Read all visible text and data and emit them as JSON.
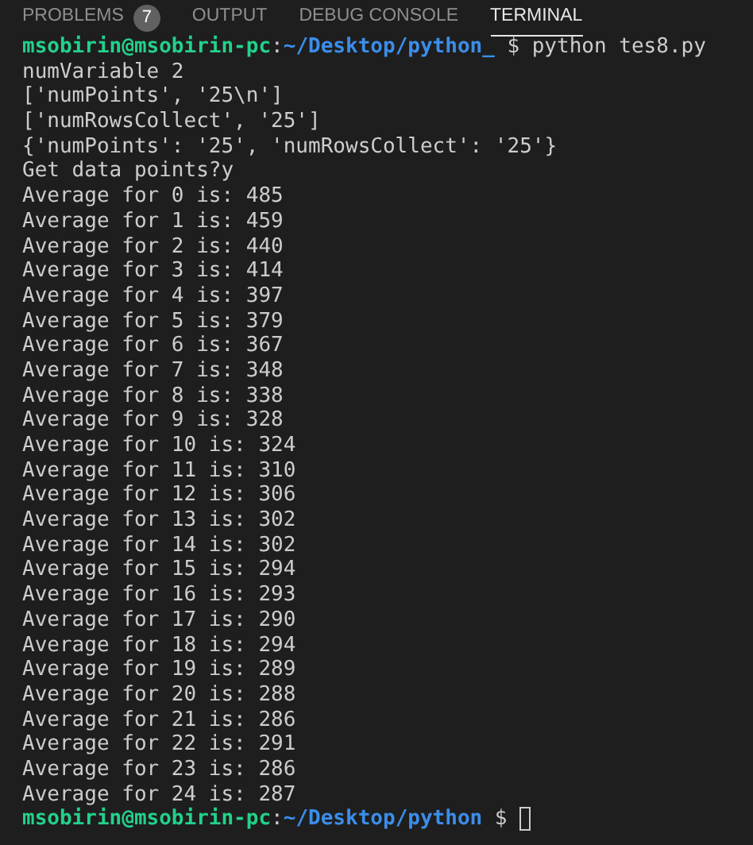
{
  "tabs": [
    {
      "label": "PROBLEMS",
      "badge": "7",
      "selected": false
    },
    {
      "label": "OUTPUT",
      "selected": false
    },
    {
      "label": "DEBUG CONSOLE",
      "selected": false
    },
    {
      "label": "TERMINAL",
      "selected": true
    }
  ],
  "terminal": {
    "lines": [
      {
        "kind": "prompt",
        "user_host": "msobirin@msobirin-pc",
        "separator": ":",
        "path": "~/Desktop/python_",
        "symbol": "$",
        "command": "python tes8.py",
        "cursor": false
      },
      {
        "kind": "output",
        "text": "numVariable 2"
      },
      {
        "kind": "output",
        "text": "['numPoints', '25\\n']"
      },
      {
        "kind": "output",
        "text": "['numRowsCollect', '25']"
      },
      {
        "kind": "output",
        "text": "{'numPoints': '25', 'numRowsCollect': '25'}"
      },
      {
        "kind": "output",
        "text": "Get data points?y"
      },
      {
        "kind": "output",
        "text": "Average for 0 is: 485"
      },
      {
        "kind": "output",
        "text": "Average for 1 is: 459"
      },
      {
        "kind": "output",
        "text": "Average for 2 is: 440"
      },
      {
        "kind": "output",
        "text": "Average for 3 is: 414"
      },
      {
        "kind": "output",
        "text": "Average for 4 is: 397"
      },
      {
        "kind": "output",
        "text": "Average for 5 is: 379"
      },
      {
        "kind": "output",
        "text": "Average for 6 is: 367"
      },
      {
        "kind": "output",
        "text": "Average for 7 is: 348"
      },
      {
        "kind": "output",
        "text": "Average for 8 is: 338"
      },
      {
        "kind": "output",
        "text": "Average for 9 is: 328"
      },
      {
        "kind": "output",
        "text": "Average for 10 is: 324"
      },
      {
        "kind": "output",
        "text": "Average for 11 is: 310"
      },
      {
        "kind": "output",
        "text": "Average for 12 is: 306"
      },
      {
        "kind": "output",
        "text": "Average for 13 is: 302"
      },
      {
        "kind": "output",
        "text": "Average for 14 is: 302"
      },
      {
        "kind": "output",
        "text": "Average for 15 is: 294"
      },
      {
        "kind": "output",
        "text": "Average for 16 is: 293"
      },
      {
        "kind": "output",
        "text": "Average for 17 is: 290"
      },
      {
        "kind": "output",
        "text": "Average for 18 is: 294"
      },
      {
        "kind": "output",
        "text": "Average for 19 is: 289"
      },
      {
        "kind": "output",
        "text": "Average for 20 is: 288"
      },
      {
        "kind": "output",
        "text": "Average for 21 is: 286"
      },
      {
        "kind": "output",
        "text": "Average for 22 is: 291"
      },
      {
        "kind": "output",
        "text": "Average for 23 is: 286"
      },
      {
        "kind": "output",
        "text": "Average for 24 is: 287"
      },
      {
        "kind": "prompt",
        "user_host": "msobirin@msobirin-pc",
        "separator": ":",
        "path": "~/Desktop/python",
        "symbol": "$",
        "cursor": true
      }
    ]
  }
}
